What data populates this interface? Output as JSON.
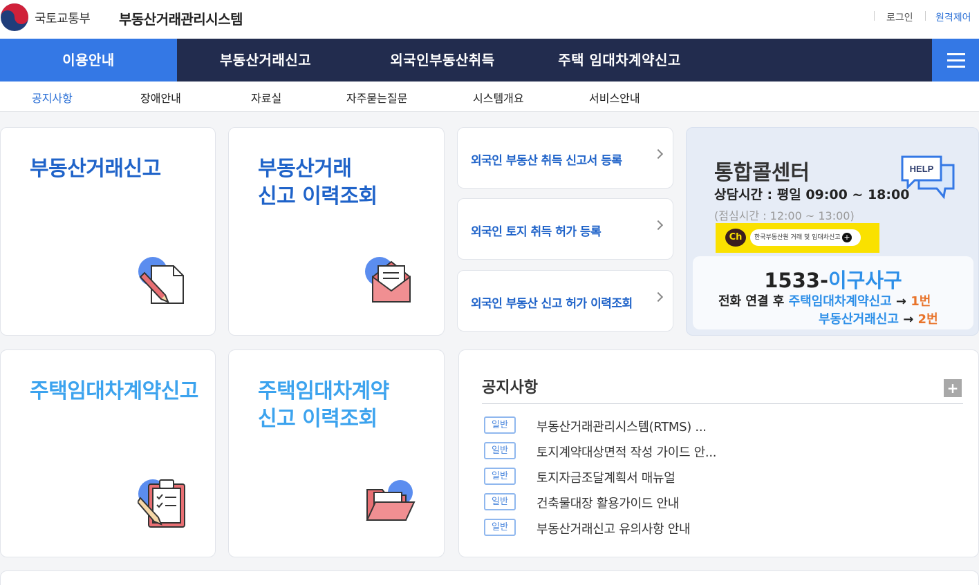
{
  "header": {
    "ministry": "국토교통부",
    "system_name": "부동산거래관리시스템",
    "login": "로그인",
    "remote": "원격제어"
  },
  "gnb": {
    "items": [
      "이용안내",
      "부동산거래신고",
      "외국인부동산취득",
      "주택 임대차계약신고"
    ],
    "active_index": 0
  },
  "subnav": {
    "items": [
      "공지사항",
      "장애안내",
      "자료실",
      "자주묻는질문",
      "시스템개요",
      "서비스안내"
    ],
    "active_index": 0
  },
  "cards": {
    "realestate_report": {
      "title": "부동산거래신고",
      "icon": "document-pen-icon"
    },
    "realestate_history": {
      "title_line1": "부동산거래",
      "title_line2": "신고 이력조회",
      "icon": "envelope-icon"
    },
    "lease_report": {
      "title": "주택임대차계약신고",
      "icon": "clipboard-checklist-icon"
    },
    "lease_history": {
      "title_line1": "주택임대차계약",
      "title_line2": "신고 이력조회",
      "icon": "folder-icon"
    }
  },
  "foreign_links": [
    "외국인 부동산 취득 신고서 등록",
    "외국인 토지 취득 허가 등록",
    "외국인 부동산 신고 허가 이력조회"
  ],
  "callcenter": {
    "title": "통합콜센터",
    "hours": "상담시간 : 평일 09:00 ~ 18:00",
    "lunch": "(점심시간 : 12:00 ~ 13:00)",
    "help_icon_text": "HELP",
    "kakao_ch": "Ch",
    "kakao_label": "한국부동산원 거래 및 임대차신고",
    "phone_number": "1533-",
    "phone_word": "이구사구",
    "route1_prefix": "전화 연결 후 ",
    "route1_service": "주택임대차계약신고",
    "route1_arrow": " → ",
    "route1_num": "1번",
    "route2_service": "부동산거래신고",
    "route2_arrow": " → ",
    "route2_num": "2번"
  },
  "notice": {
    "title": "공지사항",
    "more": "+",
    "items": [
      {
        "badge": "일반",
        "text": "부동산거래관리시스템(RTMS) ..."
      },
      {
        "badge": "일반",
        "text": "토지계약대상면적 작성 가이드 안..."
      },
      {
        "badge": "일반",
        "text": "토지자금조달계획서 매뉴얼"
      },
      {
        "badge": "일반",
        "text": "건축물대장 활용가이드 안내"
      },
      {
        "badge": "일반",
        "text": "부동산거래신고 유의사항 안내"
      }
    ]
  },
  "colors": {
    "gnb_bg": "#222c4e",
    "accent": "#3478e5",
    "title_blue": "#1f63c9",
    "light_blue": "#3ca3ee",
    "orange": "#e8732a",
    "kakao_yellow": "#fae100"
  }
}
